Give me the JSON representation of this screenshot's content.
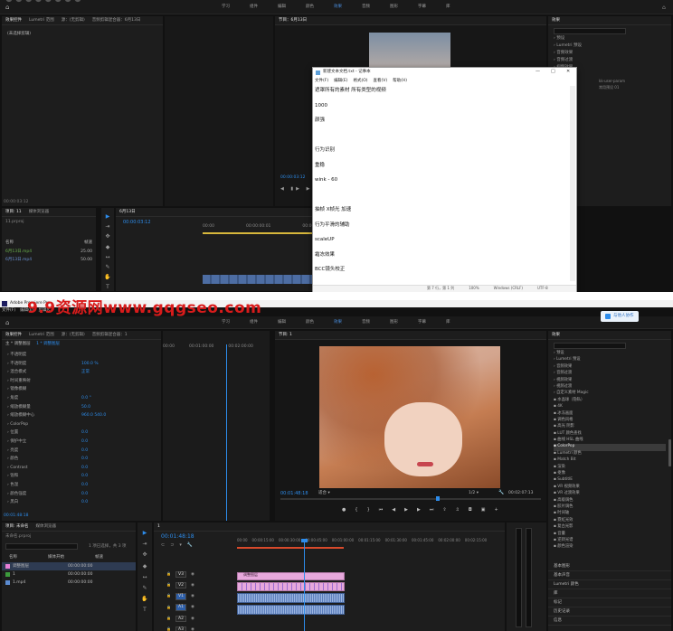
{
  "top": {
    "menu": [
      "学习",
      "组件",
      "编辑",
      "颜色",
      "效果",
      "音频",
      "图形",
      "字幕",
      "库"
    ],
    "active": "效果",
    "project_tab": "效果控件",
    "lumetri_tab": "Lumetri 范围",
    "source_tab": "源：(无剪辑)",
    "mixer_tab": "音频剪辑混合器：6月13日",
    "no_clip": "(未选择剪辑)",
    "program_title": "节目：6月13日",
    "program_time": "00:00:03:12",
    "left_time": "00:00:03:12",
    "project_label": "项目: 11",
    "project_file": "11.prproj",
    "media_tab": "媒体浏览器",
    "col_name": "名称",
    "col_rate": "帧速",
    "bins": [
      {
        "name": "6月13日.mp4",
        "rate": "25.00"
      },
      {
        "name": "6月13日.mp4",
        "rate": "50.00"
      }
    ],
    "seq_tab": "6月13日",
    "seq_time": "00:00:03:12",
    "ruler": [
      "00:00",
      "00:00:00:01",
      "00:00:00:02"
    ],
    "effects_title": "效果",
    "effects_items": [
      "预设",
      "Lumetri 预设",
      "音频效果",
      "音频过渡",
      "视频效果",
      "视频过渡"
    ],
    "effects_extra": [
      "kk-user-param",
      "常用预设 01"
    ],
    "effects_lines": [
      "[x]",
      "[x]",
      "[x]",
      "[x]",
      "[x]",
      "[x]",
      "[x]",
      "[x]",
      "[x]",
      "[x]",
      "[x]",
      "[x]",
      "[x]"
    ]
  },
  "notepad": {
    "title": "新建文本文档.txt - 记事本",
    "menu": [
      "文件(F)",
      "编辑(E)",
      "格式(O)",
      "查看(V)",
      "帮助(H)"
    ],
    "lines": [
      "遮罩所有的素材 所有类型的视频",
      "1000",
      "颜强",
      "",
      "行为识别",
      "重稳",
      "wink - 60",
      "",
      "抽帧  X帧光 加速",
      "行为平滑的辅助",
      "scaleUP",
      "霜冻效果",
      "BCC镜头校正"
    ],
    "status": [
      "第 7 行，第 1 列",
      "100%",
      "Windows (CRLF)",
      "UTF-8"
    ],
    "min": "—",
    "max": "□",
    "close": "✕"
  },
  "watermark": "9.9资源网www.gqgseo.com",
  "bottom": {
    "app_title": "Adobe Premiere Pro",
    "menu": [
      "文件(F)",
      "编辑(E)",
      "剪辑(C)"
    ],
    "workspaces": [
      "学习",
      "组件",
      "编辑",
      "颜色",
      "效果",
      "音频",
      "图形",
      "字幕",
      "库"
    ],
    "active_ws": "效果",
    "share": "与他人协作",
    "effect_controls_tab": "效果控件",
    "lumetri_tab": "Lumetri 范围",
    "source_tab": "源：(无剪辑)",
    "mixer_tab": "音频剪辑混合器：1",
    "clip_header": "主 * 调整图层",
    "seq_header": "1 * 调整图层",
    "ec_times": [
      "00:00",
      "00:01:00:00",
      "00:02:00:00"
    ],
    "fx_rows": [
      {
        "label": "不透明度",
        "value": ""
      },
      {
        "label": "不透明度",
        "value": "100.0 %"
      },
      {
        "label": "混合模式",
        "value": "正常"
      },
      {
        "label": "时间重映射",
        "value": ""
      },
      {
        "label": "镜像模糊",
        "value": ""
      },
      {
        "label": "角度",
        "value": "0.0 °"
      },
      {
        "label": "缩放模糊量",
        "value": "50.0"
      },
      {
        "label": "缩放模糊中心",
        "value": "960.0    540.0"
      },
      {
        "label": "ColorPop",
        "value": ""
      },
      {
        "label": "位置",
        "value": "0.0"
      },
      {
        "label": "保护中立",
        "value": "0.0"
      },
      {
        "label": "亮度",
        "value": "0.0"
      },
      {
        "label": "颜色",
        "value": "0.0"
      },
      {
        "label": "Contrast",
        "value": "0.0"
      },
      {
        "label": "饱和",
        "value": "0.0"
      },
      {
        "label": "色温",
        "value": "0.0"
      },
      {
        "label": "颜色强度",
        "value": "0.0"
      },
      {
        "label": "黑白",
        "value": "0.0"
      }
    ],
    "ec_time": "00:01:48:18",
    "program_title": "节目: 1",
    "program_time": "00:01:48:18",
    "fit": "适合",
    "quality": "1/2",
    "duration": "00:02:07:13",
    "project_tab": "项目: 未命名",
    "media_tab": "媒体浏览器",
    "project_file": "未命名.prproj",
    "in_out": "1 项已选择，共 3 项",
    "col_name": "名称",
    "col_media_start": "媒体开始",
    "col_rate": "帧速",
    "bins": [
      {
        "name": "调整图层",
        "start": "00:00:00:00",
        "color": "#e67fd6"
      },
      {
        "name": "1",
        "start": "00:00:00:00",
        "color": "#3c9a3c"
      },
      {
        "name": "1.mp4",
        "start": "00:00:00:00",
        "color": "#5b8bd0"
      }
    ],
    "seq_tab": "1",
    "seq_time": "00:01:48:18",
    "ruler": [
      "00:00",
      "00:00:15:00",
      "00:00:30:00",
      "00:00:45:00",
      "00:01:00:00",
      "00:01:15:00",
      "00:01:30:00",
      "00:01:45:00",
      "00:02:00:00",
      "00:02:15:00"
    ],
    "tracks": [
      "V3",
      "V2",
      "V1",
      "A1",
      "A2",
      "A3"
    ],
    "clip_label": "调整图层",
    "effects_title": "效果",
    "effects_tree": [
      "预设",
      "Lumetri 预设",
      "音频效果",
      "音频过渡",
      "视频效果",
      "视频过渡",
      "自定义素材 Magic",
      "水晶球（隐私）",
      "4K",
      "冰冻画面",
      "调色风格",
      "高光 阴影",
      "LUT 颜色查找",
      "曲线 HSL 曲线",
      "ColorPop",
      "Lumetri 颜色",
      "Match Bit",
      "渲染",
      "抠像",
      "SubtitlE",
      "VR 视频效果",
      "VR 过渡效果",
      "高级调色",
      "胶片调色",
      "时间轴",
      "霓虹光效",
      "复古光影",
      "音量",
      "逆转光谱",
      "颜色渲染"
    ],
    "effects_selected": "ColorPop",
    "effects_bottom": [
      "基本图形",
      "基本声音",
      "Lumetri 颜色",
      "库",
      "标记",
      "历史记录",
      "信息"
    ]
  },
  "colors": {
    "accent": "#2d8ceb",
    "clip_pink": "#e7a8dc",
    "audio_blue": "#6b8fc7",
    "watermark": "#d81b1b"
  }
}
